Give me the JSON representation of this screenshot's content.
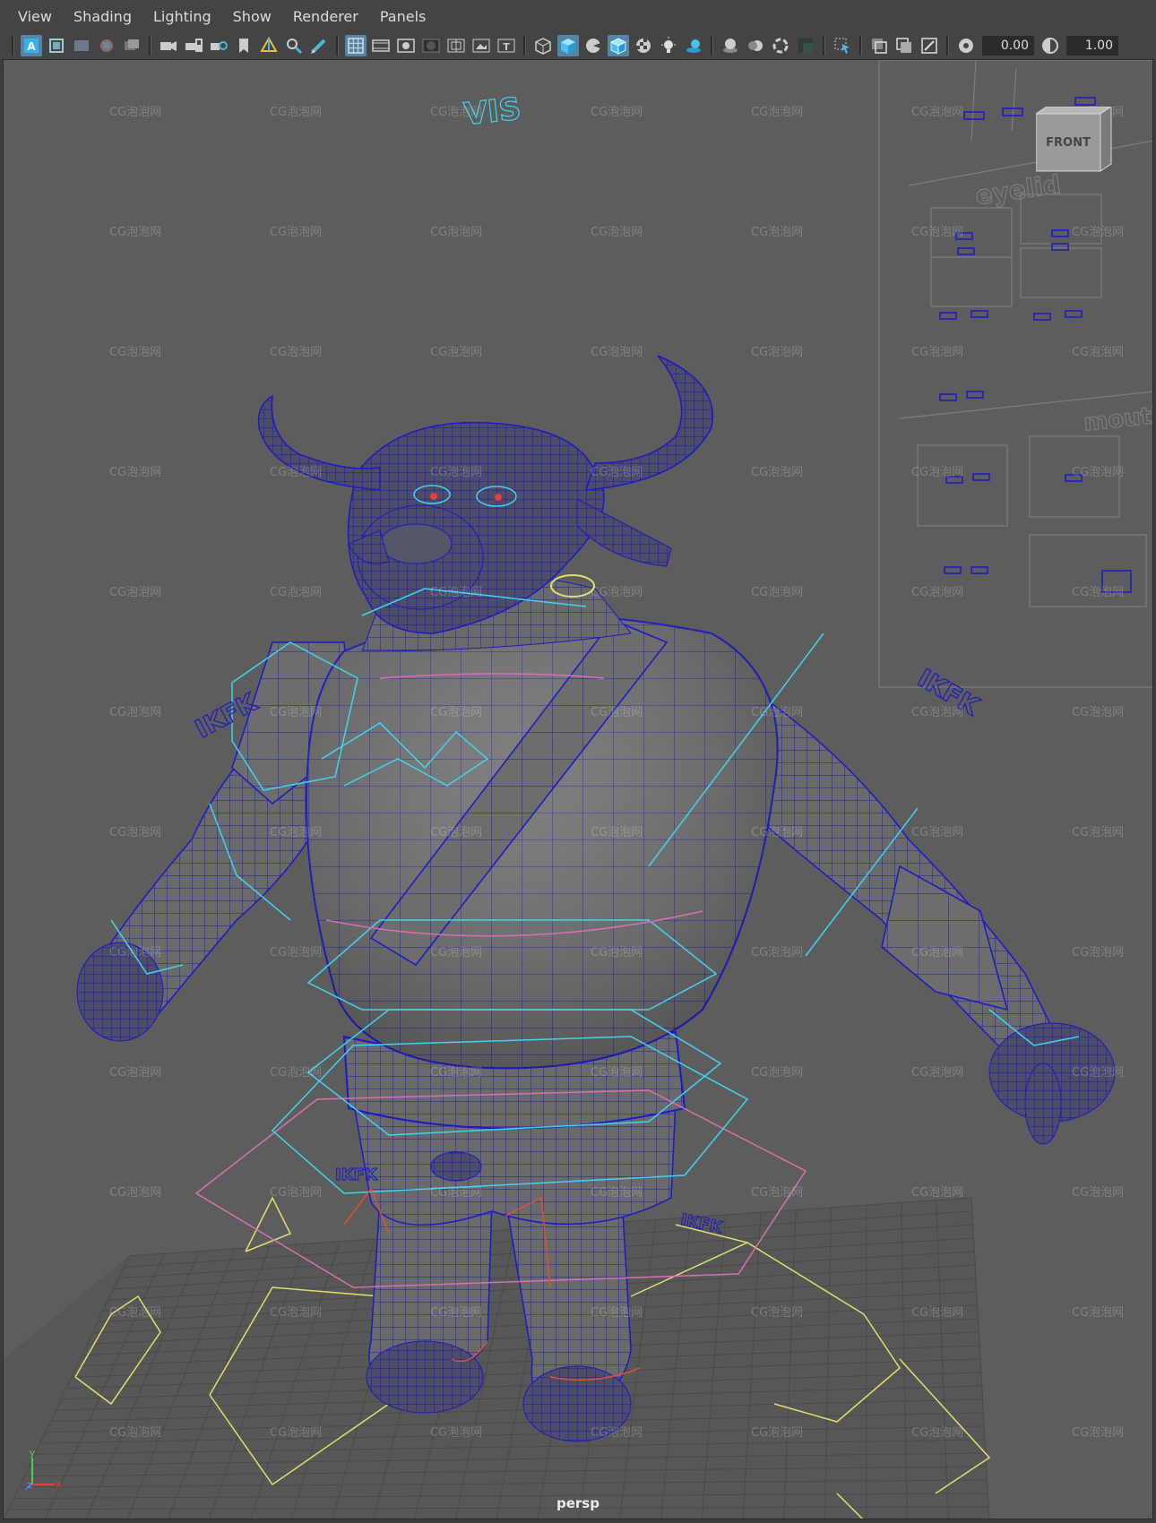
{
  "menu": [
    "View",
    "Shading",
    "Lighting",
    "Show",
    "Renderer",
    "Panels"
  ],
  "toolbar": {
    "exposure_value": "0.00",
    "gamma_value": "1.00"
  },
  "viewport": {
    "camera": "persp",
    "viewcube_face": "FRONT",
    "axis": {
      "y": "y",
      "z": "z",
      "x": "x"
    },
    "labels": {
      "vis": "VIS",
      "ikfk_left": "IKFK",
      "ikfk_right": "IKFK",
      "ikfk_leg_left": "IKFK",
      "ikfk_leg_right": "IKFK",
      "eyelid": "eyelid",
      "mouth": "mouth"
    },
    "watermark": "CG泡泡网"
  },
  "colors": {
    "wire": "#1a1ac8",
    "control_cyan": "#3fd4f0",
    "control_pink": "#d86fb5",
    "control_yellow": "#e2de6a",
    "active_tool": "#5285a6"
  }
}
